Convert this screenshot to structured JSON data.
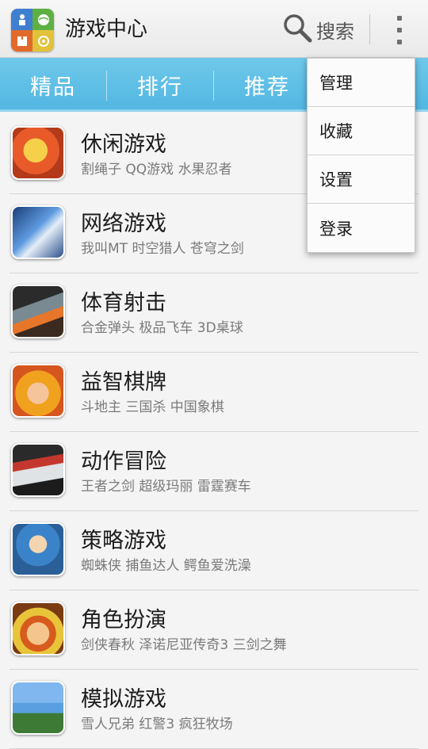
{
  "app": {
    "title": "游戏中心",
    "icon": "game-center-icon"
  },
  "header": {
    "search_label": "搜索",
    "search_icon": "search-icon",
    "overflow_icon": "overflow-menu-icon"
  },
  "tabs": [
    {
      "label": "精品"
    },
    {
      "label": "排行"
    },
    {
      "label": "推荐"
    }
  ],
  "menu": {
    "items": [
      {
        "label": "管理"
      },
      {
        "label": "收藏"
      },
      {
        "label": "设置"
      },
      {
        "label": "登录"
      }
    ]
  },
  "categories": [
    {
      "title": "休闲游戏",
      "subtitle": "割绳子  QQ游戏  水果忍者",
      "icon": "casual-games-icon",
      "color": "#e95a2a"
    },
    {
      "title": "网络游戏",
      "subtitle": "我叫MT  时空猎人  苍穹之剑",
      "icon": "online-games-icon",
      "color": "#3d6fb8"
    },
    {
      "title": "体育射击",
      "subtitle": "合金弹头  极品飞车  3D桌球",
      "icon": "sports-shooting-icon",
      "color": "#5a6470"
    },
    {
      "title": "益智棋牌",
      "subtitle": "斗地主  三国杀  中国象棋",
      "icon": "puzzle-cards-icon",
      "color": "#f0a21e"
    },
    {
      "title": "动作冒险",
      "subtitle": "王者之剑  超级玛丽  雷霆赛车",
      "icon": "action-adventure-icon",
      "color": "#c4372e"
    },
    {
      "title": "策略游戏",
      "subtitle": "蜘蛛侠  捕鱼达人  鳄鱼爱洗澡",
      "icon": "strategy-games-icon",
      "color": "#3a83c9"
    },
    {
      "title": "角色扮演",
      "subtitle": "剑侠春秋  泽诺尼亚传奇3  三剑之舞",
      "icon": "role-playing-icon",
      "color": "#d65b1c"
    },
    {
      "title": "模拟游戏",
      "subtitle": "雪人兄弟  红警3  疯狂牧场",
      "icon": "simulation-games-icon",
      "color": "#5aa0e0"
    }
  ]
}
